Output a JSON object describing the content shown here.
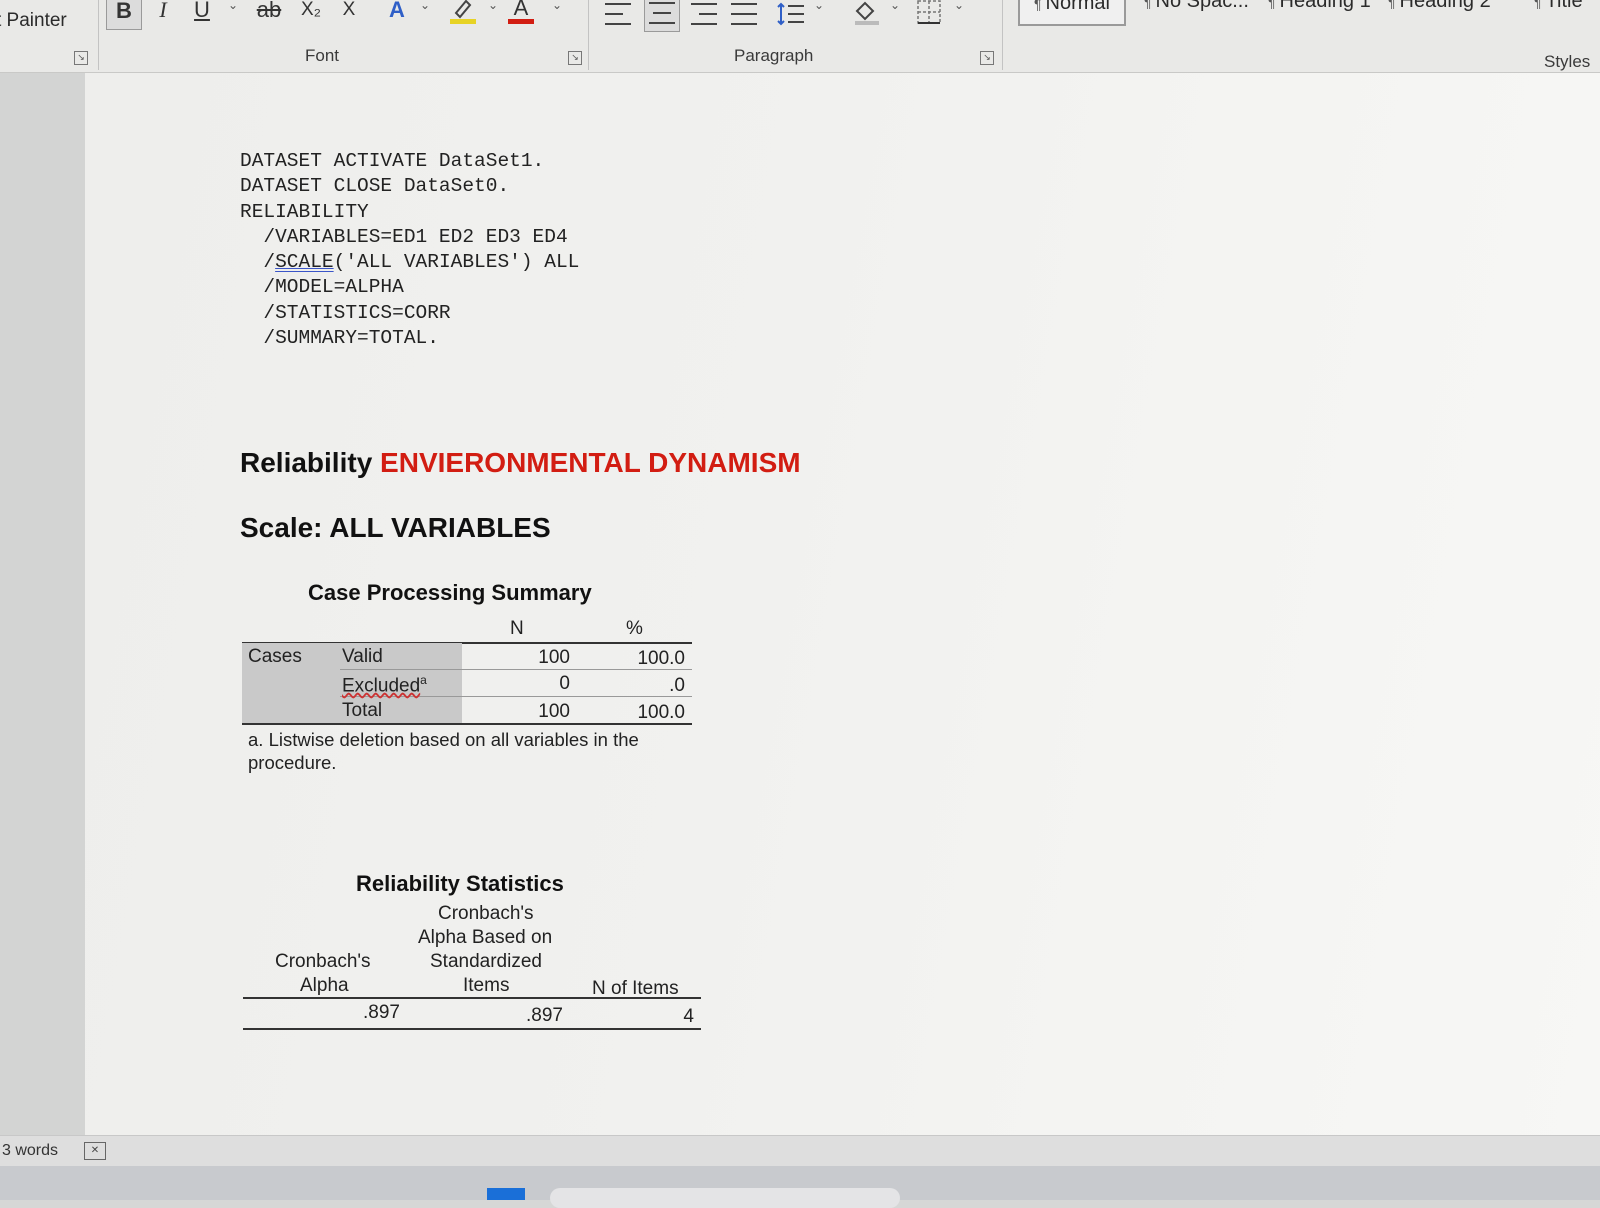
{
  "ribbon": {
    "clipboard": {
      "format_painter": "t Painter"
    },
    "font": {
      "label": "Font",
      "bold": "B",
      "italic": "I",
      "underline": "U",
      "strikethrough": "ab",
      "subscript": "X₂",
      "superscript": "X",
      "text_effects": "A",
      "font_color": "A"
    },
    "paragraph": {
      "label": "Paragraph"
    },
    "styles": {
      "label": "Styles",
      "items": [
        "Normal",
        "No Spac...",
        "Heading 1",
        "Heading 2",
        "Title"
      ],
      "selected": "Normal"
    }
  },
  "document": {
    "syntax_lines": [
      "DATASET ACTIVATE DataSet1.",
      "DATASET CLOSE DataSet0.",
      "RELIABILITY",
      "  /VARIABLES=ED1 ED2 ED3 ED4",
      "  /MODEL=ALPHA",
      "  /STATISTICS=CORR",
      "  /SUMMARY=TOTAL."
    ],
    "scale_line": {
      "prefix": "  /",
      "keyword": "SCALE",
      "rest": "('ALL VARIABLES') ALL"
    },
    "output_title": {
      "prefix": "Reliability ",
      "highlight": "ENVIERONMENTAL DYNAMISM"
    },
    "scale_title": "Scale: ALL VARIABLES",
    "case_summary": {
      "title": "Case Processing Summary",
      "col_n": "N",
      "col_pct": "%",
      "group_label": "Cases",
      "rows": [
        {
          "label": "Valid",
          "n": "100",
          "pct": "100.0"
        },
        {
          "label": "Excluded",
          "sup": "a",
          "n": "0",
          "pct": ".0"
        },
        {
          "label": "Total",
          "n": "100",
          "pct": "100.0"
        }
      ],
      "footnote_line1": "a. Listwise deletion based on all variables in the",
      "footnote_line2": "procedure."
    },
    "reliability_stats": {
      "title": "Reliability Statistics",
      "col1": [
        "Cronbach's",
        "Alpha"
      ],
      "col2": [
        "Cronbach's",
        "Alpha Based on",
        "Standardized",
        "Items"
      ],
      "col3": "N of Items",
      "values": {
        "alpha": ".897",
        "std_alpha": ".897",
        "n_items": "4"
      }
    }
  },
  "statusbar": {
    "word_count": "3 words"
  }
}
